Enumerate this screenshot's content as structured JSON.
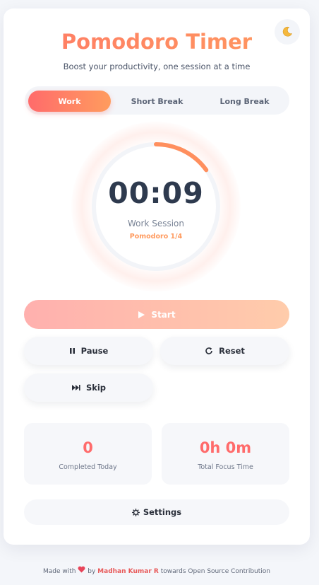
{
  "theme_toggle": {
    "icon": "moon-icon"
  },
  "header": {
    "title": "Pomodoro Timer",
    "subtitle": "Boost your productivity, one session at a time"
  },
  "mode_tabs": [
    {
      "label": "Work",
      "active": true
    },
    {
      "label": "Short Break",
      "active": false
    },
    {
      "label": "Long Break",
      "active": false
    }
  ],
  "timer": {
    "time": "00:09",
    "session_label": "Work Session",
    "pomodoro_count": "Pomodoro 1/4",
    "progress_fraction": 0.15,
    "ring_color": "#ff8f5e"
  },
  "controls": {
    "start_label": "Start",
    "start_icon": "play-icon",
    "pause_label": "Pause",
    "pause_icon": "pause-icon",
    "reset_label": "Reset",
    "reset_icon": "reset-icon",
    "skip_label": "Skip",
    "skip_icon": "skip-icon"
  },
  "stats": [
    {
      "value": "0",
      "label": "Completed Today"
    },
    {
      "value": "0h 0m",
      "label": "Total Focus Time"
    }
  ],
  "settings": {
    "label": "Settings",
    "icon": "gear-icon"
  },
  "footer": {
    "made_with": "Made with",
    "by": "by",
    "author": "Madhan Kumar R",
    "suffix": "towards Open Source Contribution",
    "heart_icon": "heart-icon"
  },
  "colors": {
    "accent_start": "#ff6b6b",
    "accent_end": "#ff9c5e",
    "stat_value": "#ff6b6b"
  }
}
